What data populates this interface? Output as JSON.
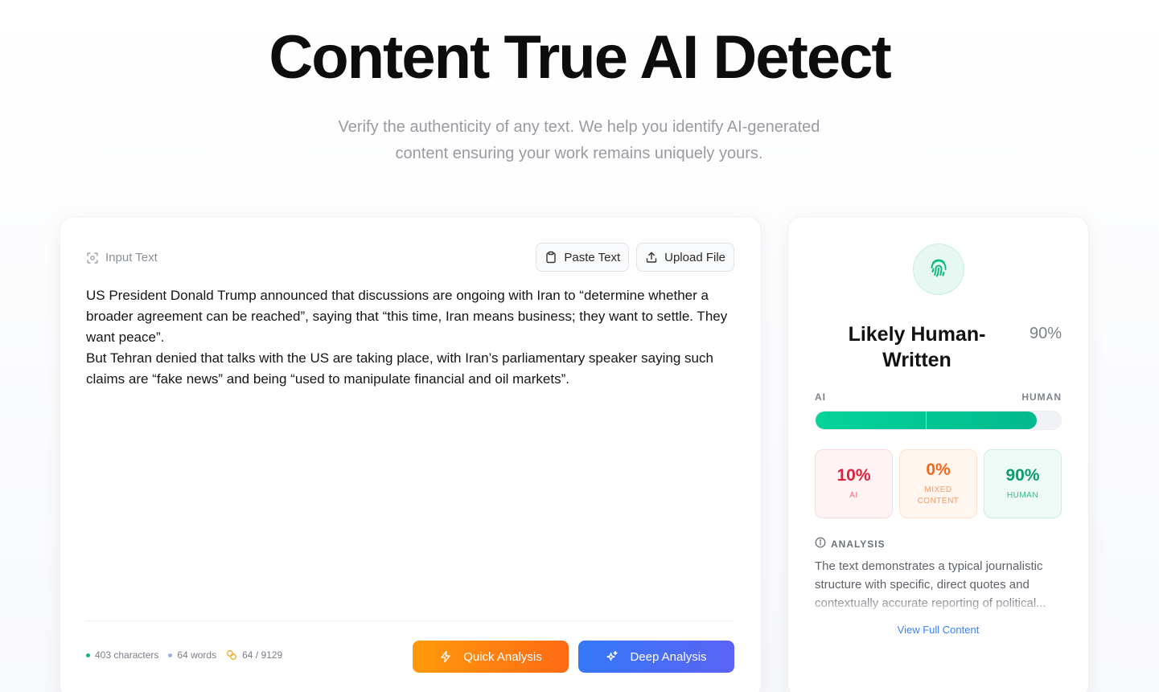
{
  "hero": {
    "title": "Content True AI Detect",
    "subtitle": "Verify the authenticity of any text. We help you identify AI-generated content ensuring your work remains uniquely yours."
  },
  "input": {
    "label": "Input Text",
    "label_icon": "scan-icon",
    "paste_label": "Paste Text",
    "paste_icon": "clipboard-icon",
    "upload_label": "Upload File",
    "upload_icon": "upload-icon",
    "paragraph1": "US President Donald Trump announced that discussions are ongoing with Iran to “determine whether a broader agreement can be reached”, saying that “this time, Iran means business; they want to settle. They want peace”.",
    "paragraph2": "But Tehran denied that talks with the US are taking place, with Iran’s parliamentary speaker saying such claims are “fake news” and being “used to manipulate financial and oil markets”."
  },
  "stats": {
    "characters": "403 characters",
    "words": "64 words",
    "quota": "64 / 9129",
    "characters_color": "#10b981",
    "words_color": "#93b4f5",
    "quota_color": "#f5a524"
  },
  "actions": {
    "quick_label": "Quick Analysis",
    "quick_icon": "bolt-icon",
    "deep_label": "Deep Analysis",
    "deep_icon": "sparkle-icon"
  },
  "result": {
    "icon": "fingerprint-icon",
    "verdict": "Likely Human-Written",
    "verdict_percent": "90%",
    "bar_left_label": "AI",
    "bar_right_label": "HUMAN",
    "human_fraction": 0.9,
    "scores": {
      "ai_value": "10%",
      "ai_label": "AI",
      "mixed_value": "0%",
      "mixed_label": "MIXED CONTENT",
      "human_value": "90%",
      "human_label": "HUMAN"
    },
    "analysis_heading": "ANALYSIS",
    "analysis_text": "The text demonstrates a typical journalistic structure with specific, direct quotes and contextually accurate reporting of political...",
    "view_full_label": "View Full Content"
  }
}
